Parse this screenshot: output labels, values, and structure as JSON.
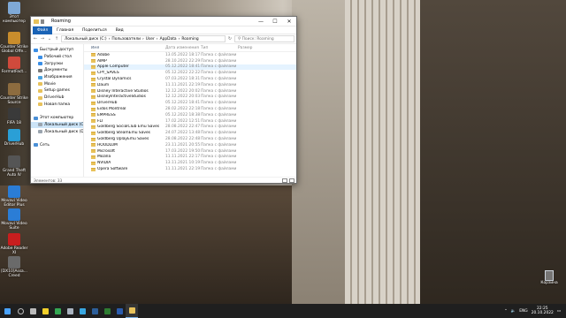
{
  "desktop_icons": [
    {
      "label": "Этот компьютер",
      "icon": "computer-icon",
      "color": "#7fa9d6"
    },
    {
      "label": "Counter Strike Global Offe...",
      "icon": "cs-icon",
      "color": "#c98d2c"
    },
    {
      "label": "FormatFact...",
      "icon": "formatfactory-icon",
      "color": "#d04a3c"
    },
    {
      "label": "Counter Strike Source",
      "icon": "css-icon",
      "color": "#8d6c3f"
    },
    {
      "label": "FIFA 18",
      "icon": "fifa-icon",
      "color": "#3a3a3a"
    },
    {
      "label": "DriverHub",
      "icon": "driverhub-icon",
      "color": "#2a9fd6"
    },
    {
      "label": "Grand Theft Auto IV",
      "icon": "gta-icon",
      "color": "#555"
    },
    {
      "label": "Movavi Video Editor Plus",
      "icon": "movavi-icon",
      "color": "#2b7dd6"
    },
    {
      "label": "Movavi Video Suite",
      "icon": "movavi-suite-icon",
      "color": "#2b7dd6"
    },
    {
      "label": "Adobe Reader XI",
      "icon": "adobe-icon",
      "color": "#c81e1e"
    },
    {
      "label": "[DX10]Assa... Creed",
      "icon": "assassin-icon",
      "color": "#6a6a6a"
    }
  ],
  "window": {
    "title": "Roaming",
    "minimize": "—",
    "maximize": "☐",
    "close": "✕",
    "ribbon_tabs": [
      "Файл",
      "Главная",
      "Поделиться",
      "Вид"
    ],
    "breadcrumb": [
      "Локальный диск (C:)",
      "Пользователи",
      "User",
      "AppData",
      "Roaming"
    ],
    "search_placeholder": "Поиск: Roaming",
    "nav_items": [
      {
        "label": "Быстрый доступ",
        "color": "#3a8ee6"
      },
      {
        "label": "Рабочий стол",
        "color": "#3a8ee6"
      },
      {
        "label": "Загрузки",
        "color": "#3a8ee6"
      },
      {
        "label": "Документы",
        "color": "#7a7a7a"
      },
      {
        "label": "Изображения",
        "color": "#4aa3e0"
      },
      {
        "label": "Movie",
        "color": "#e8c25b"
      },
      {
        "label": "Setup games",
        "color": "#e8c25b"
      },
      {
        "label": "DriverHub",
        "color": "#e8c25b"
      },
      {
        "label": "Новая папка",
        "color": "#e8c25b"
      },
      {
        "label": "",
        "color": "transparent"
      },
      {
        "label": "Этот компьютер",
        "color": "#4a8fd6"
      },
      {
        "label": "Локальный диск (C:)",
        "color": "#9aa4ae"
      },
      {
        "label": "Локальный диск (D:)",
        "color": "#9aa4ae"
      },
      {
        "label": "",
        "color": "transparent"
      },
      {
        "label": "Сеть",
        "color": "#4a8fd6"
      }
    ],
    "columns": {
      "name": "Имя",
      "date": "Дата изменения",
      "type": "Тип",
      "size": "Размер"
    },
    "files": [
      {
        "name": "Adobe",
        "date": "13.05.2022 18:17",
        "type": "Папка с файлами"
      },
      {
        "name": "AIMP",
        "date": "28.10.2022 22:29",
        "type": "Папка с файлами"
      },
      {
        "name": "Apple Computer",
        "date": "05.12.2022 18:41",
        "type": "Папка с файлами"
      },
      {
        "name": "CPY_SAVES",
        "date": "05.12.2022 22:22",
        "type": "Папка с файлами"
      },
      {
        "name": "Crystal Dynamics",
        "date": "07.03.2022 18:31",
        "type": "Папка с файлами"
      },
      {
        "name": "Daum",
        "date": "11.11.2021 22:19",
        "type": "Папка с файлами"
      },
      {
        "name": "Disney Interactive Studios",
        "date": "12.12.2022 20:02",
        "type": "Папка с файлами"
      },
      {
        "name": "DisneyInteractiveStudios",
        "date": "12.12.2022 20:03",
        "type": "Папка с файлами"
      },
      {
        "name": "DriverHub",
        "date": "05.12.2022 18:41",
        "type": "Папка с файлами"
      },
      {
        "name": "Eidos Montreal",
        "date": "28.02.2022 22:18",
        "type": "Папка с файлами"
      },
      {
        "name": "EMPRESS",
        "date": "05.12.2022 18:38",
        "type": "Папка с файлами"
      },
      {
        "name": "FLT",
        "date": "17.02.2022 12:51",
        "type": "Папка с файлами"
      },
      {
        "name": "Goldberg SocialClub Emu Saves",
        "date": "28.08.2022 22:47",
        "type": "Папка с файлами"
      },
      {
        "name": "Goldberg SteamEmu Saves",
        "date": "24.07.2022 13:48",
        "type": "Папка с файлами"
      },
      {
        "name": "Goldberg UplayEmu Saves",
        "date": "28.08.2022 22:48",
        "type": "Папка с файлами"
      },
      {
        "name": "HOODLUM",
        "date": "23.11.2021 20:55",
        "type": "Папка с файлами"
      },
      {
        "name": "Microsoft",
        "date": "17.03.2022 19:50",
        "type": "Папка с файлами"
      },
      {
        "name": "Mozilla",
        "date": "11.11.2021 22:17",
        "type": "Папка с файлами"
      },
      {
        "name": "NVIDIA",
        "date": "13.11.2021 10:19",
        "type": "Папка с файлами"
      },
      {
        "name": "Opera Software",
        "date": "11.11.2021 22:19",
        "type": "Папка с файлами"
      }
    ],
    "status": "Элементов: 33"
  },
  "recycle_bin": {
    "label": "Корзина",
    "icon": "recycle-bin-icon"
  },
  "taskbar": {
    "apps": [
      {
        "icon": "windows-start-icon",
        "color": "#4aa3ff"
      },
      {
        "icon": "search-icon",
        "color": "#bbbbbb"
      },
      {
        "icon": "task-view-icon",
        "color": "#bbbbbb"
      },
      {
        "icon": "yandex-icon",
        "color": "#f2d02b"
      },
      {
        "icon": "chrome-icon",
        "color": "#34a853"
      },
      {
        "icon": "steam-icon",
        "color": "#aab4c0"
      },
      {
        "icon": "telegram-icon",
        "color": "#38a6e0"
      },
      {
        "icon": "app-icon",
        "color": "#2d5f9a"
      },
      {
        "icon": "excel-icon",
        "color": "#2e7d32"
      },
      {
        "icon": "word-icon",
        "color": "#2b5cad"
      },
      {
        "icon": "explorer-icon",
        "color": "#e8c25b"
      }
    ],
    "lang": "ENG",
    "time": "22:25",
    "date": "20.10.2022"
  }
}
